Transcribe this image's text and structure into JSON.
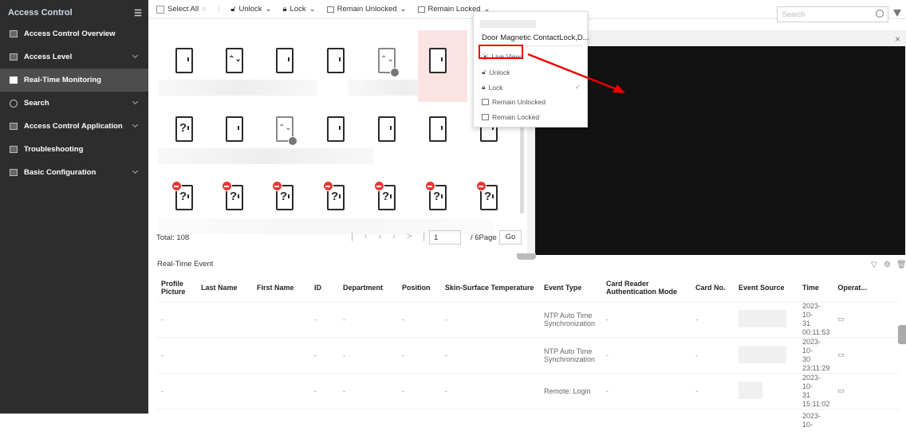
{
  "sidebar": {
    "title": "Access Control",
    "items": [
      {
        "label": "Access Control Overview",
        "has_children": false
      },
      {
        "label": "Access Level",
        "has_children": true
      },
      {
        "label": "Real-Time Monitoring",
        "has_children": false,
        "active": true
      },
      {
        "label": "Search",
        "has_children": true
      },
      {
        "label": "Access Control Application",
        "has_children": true
      },
      {
        "label": "Troubleshooting",
        "has_children": false
      },
      {
        "label": "Basic Configuration",
        "has_children": true
      }
    ]
  },
  "toolbar": {
    "select_all": "Select All",
    "unlock": "Unlock",
    "lock": "Lock",
    "remain_unlocked": "Remain Unlocked",
    "remain_locked": "Remain Locked"
  },
  "search": {
    "placeholder": "Search"
  },
  "pager": {
    "total": "Total: 108",
    "page": "1",
    "page_count": "/ 6Page",
    "go": "Go"
  },
  "context_menu": {
    "title": "Door Magnetic ContactLock,D...",
    "items": [
      "Live View",
      "Unlock",
      "Lock",
      "Remain Unlocked",
      "Remain Locked"
    ],
    "checked": "Lock"
  },
  "events": {
    "title": "Real-Time Event",
    "columns": [
      "Profile Picture",
      "Last Name",
      "First Name",
      "ID",
      "Department",
      "Position",
      "Skin-Surface Temperature",
      "Event Type",
      "Card Reader Authentication Mode",
      "Card No.",
      "Event Source",
      "Time",
      "Operat..."
    ],
    "rows": [
      {
        "profile": "-",
        "id": "-",
        "department": "-",
        "position": "-",
        "temperature": "-",
        "event_type": "NTP Auto Time Synchronization",
        "auth_mode": "-",
        "card_no": "-",
        "time": [
          "2023-10-",
          "31",
          "00:11:53"
        ]
      },
      {
        "profile": "-",
        "id": "-",
        "department": "-",
        "position": "-",
        "temperature": "-",
        "event_type": "NTP Auto Time Synchronization",
        "auth_mode": "-",
        "card_no": "-",
        "time": [
          "2023-10-",
          "30",
          "23:11:29"
        ]
      },
      {
        "profile": "-",
        "id": "-",
        "department": "-",
        "position": "-",
        "temperature": "-",
        "event_type": "Remote: Login",
        "auth_mode": "-",
        "card_no": "-",
        "time": [
          "2023-10-",
          "31",
          "15:11:02"
        ]
      },
      {
        "profile": "",
        "id": "",
        "department": "",
        "position": "",
        "temperature": "",
        "event_type": "",
        "auth_mode": "",
        "card_no": "",
        "time": [
          "2023-10-",
          "",
          ""
        ]
      }
    ]
  },
  "colors": {
    "sidebar_bg": "#2d2d2d",
    "active_item": "#4d4d4d",
    "highlight": "#e00000"
  }
}
